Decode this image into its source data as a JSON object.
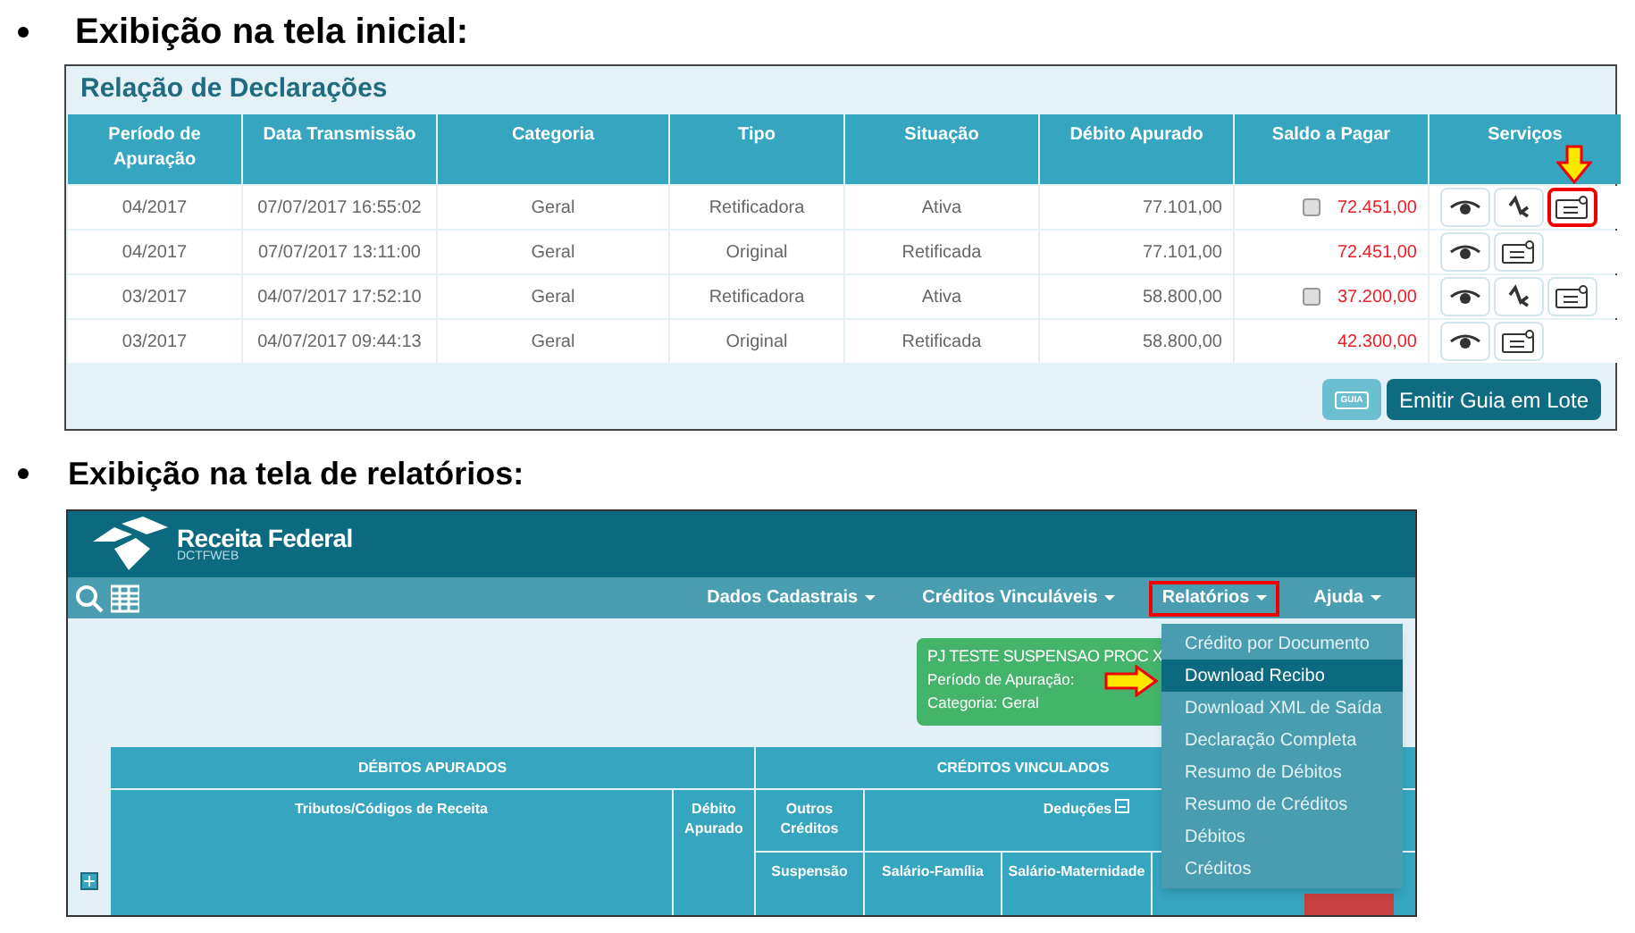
{
  "heading_1": "Exibição na tela inicial:",
  "declarations_panel": {
    "title": "Relação de Declarações",
    "columns": [
      "Período de Apuração",
      "Data Transmissão",
      "Categoria",
      "Tipo",
      "Situação",
      "Débito Apurado",
      "Saldo a Pagar",
      "Serviços"
    ],
    "rows": [
      {
        "periodo": "04/2017",
        "data": "07/07/2017 16:55:02",
        "categoria": "Geral",
        "tipo": "Retificadora",
        "situacao": "Ativa",
        "debito": "77.101,00",
        "saldo": "72.451,00",
        "has_checkbox": true,
        "services": [
          {
            "kind": "view",
            "highlighted": false
          },
          {
            "kind": "history",
            "highlighted": false
          },
          {
            "kind": "guide",
            "highlighted": true
          }
        ]
      },
      {
        "periodo": "04/2017",
        "data": "07/07/2017 13:11:00",
        "categoria": "Geral",
        "tipo": "Original",
        "situacao": "Retificada",
        "debito": "77.101,00",
        "saldo": "72.451,00",
        "has_checkbox": false,
        "services": [
          {
            "kind": "view",
            "highlighted": false
          },
          {
            "kind": "guide",
            "highlighted": false
          }
        ]
      },
      {
        "periodo": "03/2017",
        "data": "04/07/2017 17:52:10",
        "categoria": "Geral",
        "tipo": "Retificadora",
        "situacao": "Ativa",
        "debito": "58.800,00",
        "saldo": "37.200,00",
        "has_checkbox": true,
        "services": [
          {
            "kind": "view",
            "highlighted": false
          },
          {
            "kind": "history",
            "highlighted": false
          },
          {
            "kind": "guide",
            "highlighted": false
          }
        ]
      },
      {
        "periodo": "03/2017",
        "data": "04/07/2017 09:44:13",
        "categoria": "Geral",
        "tipo": "Original",
        "situacao": "Retificada",
        "debito": "58.800,00",
        "saldo": "42.300,00",
        "has_checkbox": false,
        "services": [
          {
            "kind": "view",
            "highlighted": false
          },
          {
            "kind": "guide",
            "highlighted": false
          }
        ]
      }
    ],
    "buttons": [
      {
        "kind": "icon",
        "label": "GUIA"
      },
      {
        "kind": "text",
        "label": "Emitir Guia em Lote"
      }
    ]
  },
  "heading_2": "Exibição na tela de relatórios:",
  "reports_screen": {
    "brand": "Receita Federal",
    "subtitle": "DCTFWEB",
    "menu": [
      {
        "label": "Dados Cadastrais",
        "highlighted": false
      },
      {
        "label": "Créditos Vinculáveis",
        "highlighted": false
      },
      {
        "label": "Relatórios",
        "highlighted": true
      },
      {
        "label": "Ajuda",
        "highlighted": false
      }
    ],
    "info_box": {
      "lines": [
        "PJ TESTE SUSPENSAO PROC X",
        "Período de Apuração:",
        "Categoria: Geral"
      ]
    },
    "dropdown": [
      {
        "label": "Crédito por Documento",
        "selected": false
      },
      {
        "label": "Download Recibo",
        "selected": true
      },
      {
        "label": "Download XML de Saída",
        "selected": false
      },
      {
        "label": "Declaração Completa",
        "selected": false
      },
      {
        "label": "Resumo de Débitos",
        "selected": false
      },
      {
        "label": "Resumo de Créditos",
        "selected": false
      },
      {
        "label": "Débitos",
        "selected": false
      },
      {
        "label": "Créditos",
        "selected": false
      }
    ],
    "table": {
      "group_1": "DÉBITOS APURADOS",
      "group_2": "CRÉDITOS VINCULADOS",
      "col_tributos": "Tributos/Códigos de Receita",
      "col_debito": "Débito Apurado",
      "col_outros": "Outros Créditos",
      "col_deducoes": "Deduções",
      "col_suspensao": "Suspensão",
      "col_familia": "Salário-Família",
      "col_maternidade": "Salário-Maternidade"
    }
  }
}
